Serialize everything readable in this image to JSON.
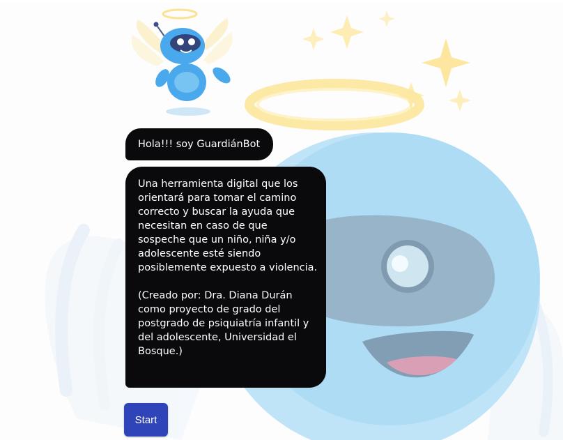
{
  "chat": {
    "greeting": "Hola!!! soy GuardiánBot",
    "message": "Una herramienta digital que los\norientará para tomar el camino\ncorrecto y buscar la ayuda que\nnecesitan en caso de que\nsospeche que un niño, niña y/o\nadolescente esté siendo\nposiblemente expuesto a violencia.\n\n(Creado por: Dra. Diana Durán\ncomo proyecto de grado del\npostgrado de psiquiatría infantil y\ndel adolescente, Universidad el\nBosque.)"
  },
  "actions": {
    "start_label": "Start"
  },
  "icons": {
    "avatar": "angel-robot-avatar-icon",
    "background": "angel-robot-background-illustration",
    "sparkles": "sparkle-icon"
  },
  "colors": {
    "bubble_bg": "#0a0a0c",
    "bubble_text": "#ffffff",
    "button_bg": "#2e44b8",
    "robot_blue": "#6ec3ee",
    "halo_yellow": "#fde9a6"
  }
}
